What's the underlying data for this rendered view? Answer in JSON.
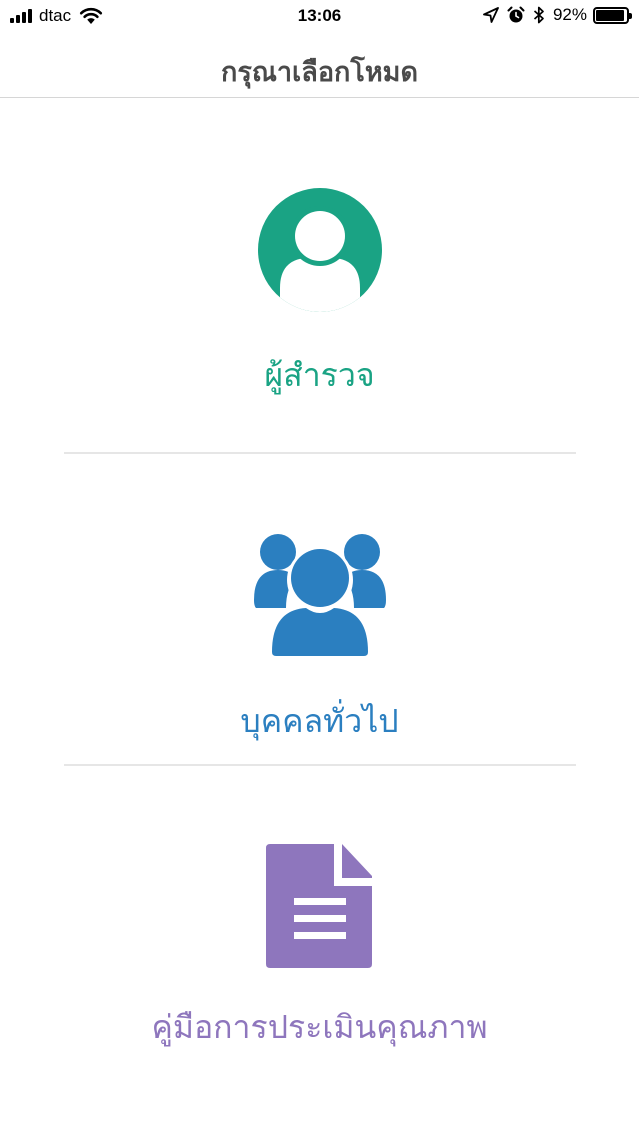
{
  "status_bar": {
    "carrier": "dtac",
    "time": "13:06",
    "battery_percent_text": "92%",
    "battery_level": 0.92,
    "icons": [
      "signal-icon",
      "wifi-icon",
      "location-icon",
      "alarm-icon",
      "bluetooth-icon",
      "battery-icon"
    ]
  },
  "nav": {
    "title": "กรุณาเลือกโหมด"
  },
  "modes": [
    {
      "label": "ผู้สำรวจ",
      "icon": "user-icon",
      "color": "#1aa384"
    },
    {
      "label": "บุคคลทั่วไป",
      "icon": "group-icon",
      "color": "#2b7fc0"
    },
    {
      "label": "คู่มือการประเมินคุณภาพ",
      "icon": "document-icon",
      "color": "#8e76bd"
    }
  ]
}
